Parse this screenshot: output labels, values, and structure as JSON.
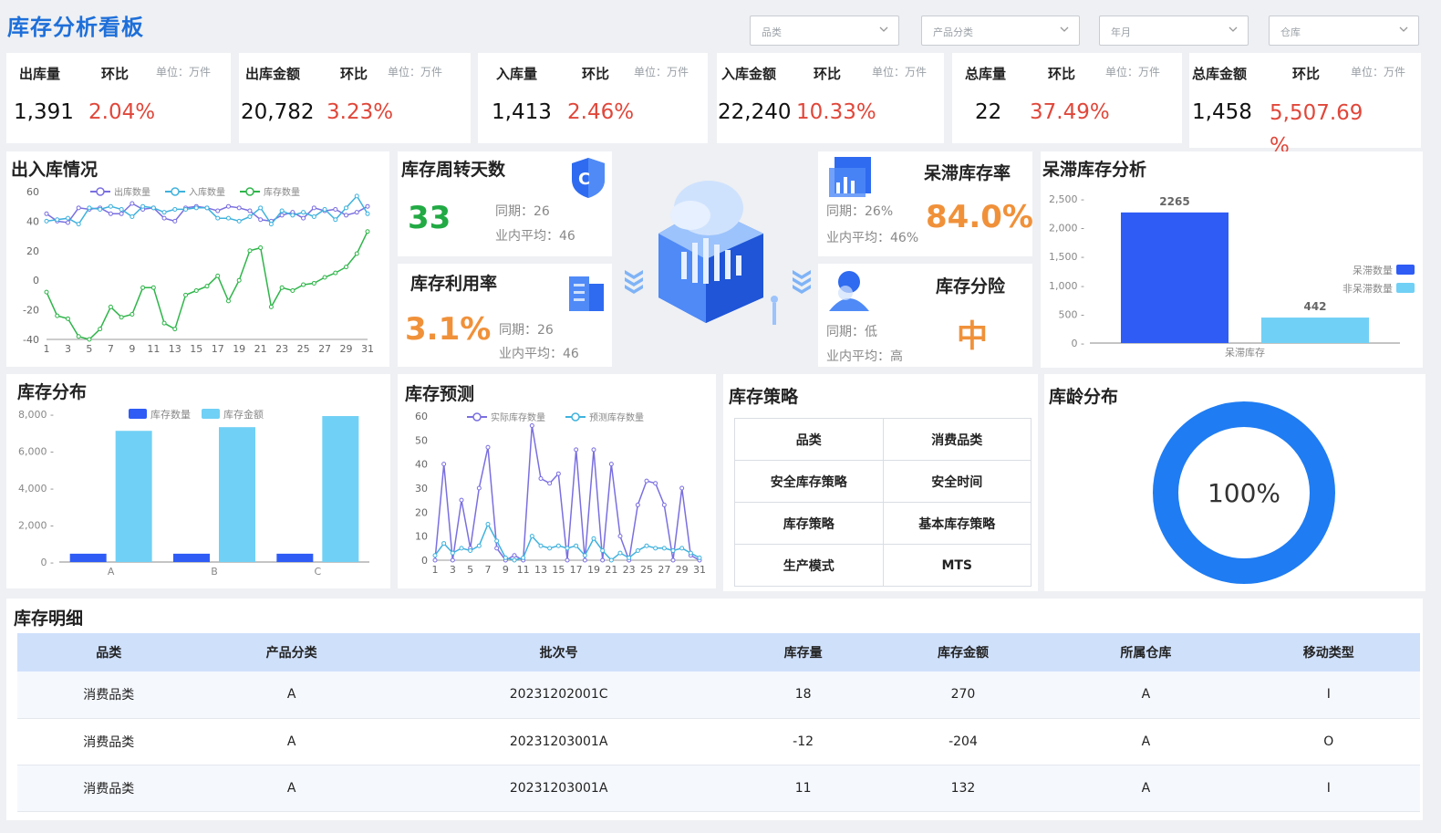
{
  "header": {
    "title": "库存分析看板",
    "filters": [
      "品类",
      "产品分类",
      "年月",
      "仓库"
    ]
  },
  "kpis": [
    {
      "name": "出库量",
      "hb": "环比",
      "unit": "单位：万件",
      "value": "1,391",
      "pct": "2.04%"
    },
    {
      "name": "出库金额",
      "hb": "环比",
      "unit": "单位：万件",
      "value": "20,782",
      "pct": "3.23%"
    },
    {
      "name": "入库量",
      "hb": "环比",
      "unit": "单位：万件",
      "value": "1,413",
      "pct": "2.46%"
    },
    {
      "name": "入库金额",
      "hb": "环比",
      "unit": "单位：万件",
      "value": "22,240",
      "pct": "10.33%"
    },
    {
      "name": "总库量",
      "hb": "环比",
      "unit": "单位：万件",
      "value": "22",
      "pct": "37.49%"
    },
    {
      "name": "总库金额",
      "hb": "环比",
      "unit": "单位：万件",
      "value": "1,458",
      "pct": "5,507.69 %"
    }
  ],
  "turnover": {
    "title": "库存周转天数",
    "value": "33",
    "period": "同期：26",
    "avg": "业内平均：46",
    "color": "#22aa44"
  },
  "utilization": {
    "title": "库存利用率",
    "value": "3.1%",
    "period": "同期：26",
    "avg": "业内平均：46",
    "color": "#f0913a"
  },
  "stagnant_rate": {
    "title": "呆滞库存率",
    "value": "84.0%",
    "period": "同期：26%",
    "avg": "业内平均：46%",
    "color": "#f0913a"
  },
  "risk": {
    "title": "库存分险",
    "value": "中",
    "period": "同期：低",
    "avg": "业内平均：高",
    "color": "#f0913a"
  },
  "sections": {
    "inout": "出入库情况",
    "stagnant": "呆滞库存分析",
    "distribution": "库存分布",
    "forecast": "库存预测",
    "strategy": "库存策略",
    "age": "库龄分布",
    "detail": "库存明细"
  },
  "strategy_rows": [
    [
      "品类",
      "消费品类"
    ],
    [
      "安全库存策略",
      "安全时间"
    ],
    [
      "库存策略",
      "基本库存策略"
    ],
    [
      "生产模式",
      "MTS"
    ]
  ],
  "detail_table": {
    "headers": [
      "品类",
      "产品分类",
      "批次号",
      "库存量",
      "库存金额",
      "所属仓库",
      "移动类型"
    ],
    "rows": [
      [
        "消费品类",
        "A",
        "20231202001C",
        "18",
        "270",
        "A",
        "I"
      ],
      [
        "消费品类",
        "A",
        "20231203001A",
        "-12",
        "-204",
        "A",
        "O"
      ],
      [
        "消费品类",
        "A",
        "20231203001A",
        "11",
        "132",
        "A",
        "I"
      ]
    ]
  },
  "chart_data": [
    {
      "id": "inout",
      "type": "line",
      "x": [
        1,
        2,
        3,
        4,
        5,
        6,
        7,
        8,
        9,
        10,
        11,
        12,
        13,
        14,
        15,
        16,
        17,
        18,
        19,
        20,
        21,
        22,
        23,
        24,
        25,
        26,
        27,
        28,
        29,
        30,
        31
      ],
      "x_ticks": [
        1,
        3,
        5,
        7,
        9,
        11,
        13,
        15,
        17,
        19,
        21,
        23,
        25,
        27,
        29,
        31
      ],
      "ylim": [
        -40,
        60
      ],
      "y_ticks": [
        60,
        40,
        20,
        0,
        -20,
        -40
      ],
      "series": [
        {
          "name": "出库数量",
          "color": "#7a6fe0",
          "values": [
            45,
            40,
            39,
            49,
            48,
            49,
            45,
            45,
            52,
            48,
            49,
            42,
            40,
            49,
            50,
            49,
            47,
            50,
            49,
            47,
            41,
            40,
            44,
            46,
            42,
            49,
            47,
            48,
            44,
            46,
            50
          ]
        },
        {
          "name": "入库数量",
          "color": "#3fb2dd",
          "values": [
            40,
            41,
            42,
            38,
            49,
            48,
            50,
            48,
            43,
            50,
            49,
            46,
            48,
            48,
            49,
            49,
            42,
            42,
            40,
            43,
            49,
            38,
            47,
            44,
            46,
            43,
            48,
            41,
            49,
            57,
            45
          ]
        },
        {
          "name": "库存数量",
          "color": "#2fb54a",
          "values": [
            -8,
            -24,
            -26,
            -38,
            -40,
            -33,
            -18,
            -25,
            -23,
            -5,
            -5,
            -29,
            -33,
            -10,
            -7,
            -4,
            3,
            -14,
            0,
            20,
            22,
            -18,
            -5,
            -7,
            -3,
            -2,
            2,
            5,
            9,
            18,
            33
          ]
        }
      ]
    },
    {
      "id": "stagnant",
      "type": "bar",
      "categories": [
        "呆滞库存"
      ],
      "ylim": [
        0,
        2500
      ],
      "y_ticks": [
        2500,
        2000,
        1500,
        1000,
        500,
        0
      ],
      "series": [
        {
          "name": "呆滞数量",
          "color": "#2f5cf5",
          "values": [
            2265
          ]
        },
        {
          "name": "非呆滞数量",
          "color": "#71d0f5",
          "values": [
            442
          ]
        }
      ]
    },
    {
      "id": "distribution",
      "type": "bar",
      "categories": [
        "A",
        "B",
        "C"
      ],
      "ylim": [
        0,
        8000
      ],
      "y_ticks": [
        8000,
        6000,
        4000,
        2000,
        0
      ],
      "series": [
        {
          "name": "库存数量",
          "color": "#2f5cf5",
          "values": [
            450,
            450,
            450
          ]
        },
        {
          "name": "库存金额",
          "color": "#71d0f5",
          "values": [
            7100,
            7300,
            7900
          ]
        }
      ]
    },
    {
      "id": "forecast",
      "type": "line",
      "x": [
        1,
        2,
        3,
        4,
        5,
        6,
        7,
        8,
        9,
        10,
        11,
        12,
        13,
        14,
        15,
        16,
        17,
        18,
        19,
        20,
        21,
        22,
        23,
        24,
        25,
        26,
        27,
        28,
        29,
        30,
        31
      ],
      "x_ticks": [
        1,
        3,
        5,
        7,
        9,
        11,
        13,
        15,
        17,
        19,
        21,
        23,
        25,
        27,
        29,
        31
      ],
      "ylim": [
        0,
        60
      ],
      "y_ticks": [
        60,
        50,
        40,
        30,
        20,
        10,
        0
      ],
      "series": [
        {
          "name": "实际库存数量",
          "color": "#7a6fe0",
          "values": [
            0,
            40,
            0,
            25,
            5,
            30,
            47,
            5,
            0,
            2,
            0,
            56,
            34,
            32,
            36,
            0,
            46,
            0,
            46,
            0,
            40,
            10,
            0,
            23,
            33,
            32,
            23,
            0,
            30,
            2,
            0
          ]
        },
        {
          "name": "预测库存数量",
          "color": "#3fb2dd",
          "values": [
            2,
            7,
            3,
            5,
            4,
            6,
            15,
            8,
            1,
            0,
            1,
            10,
            6,
            5,
            6,
            5,
            6,
            2,
            9,
            4,
            0,
            3,
            1,
            4,
            6,
            5,
            5,
            4,
            5,
            3,
            1
          ]
        }
      ]
    },
    {
      "id": "age",
      "type": "pie",
      "values": [
        100
      ],
      "label": "100%",
      "color": "#1f7cf2"
    }
  ]
}
